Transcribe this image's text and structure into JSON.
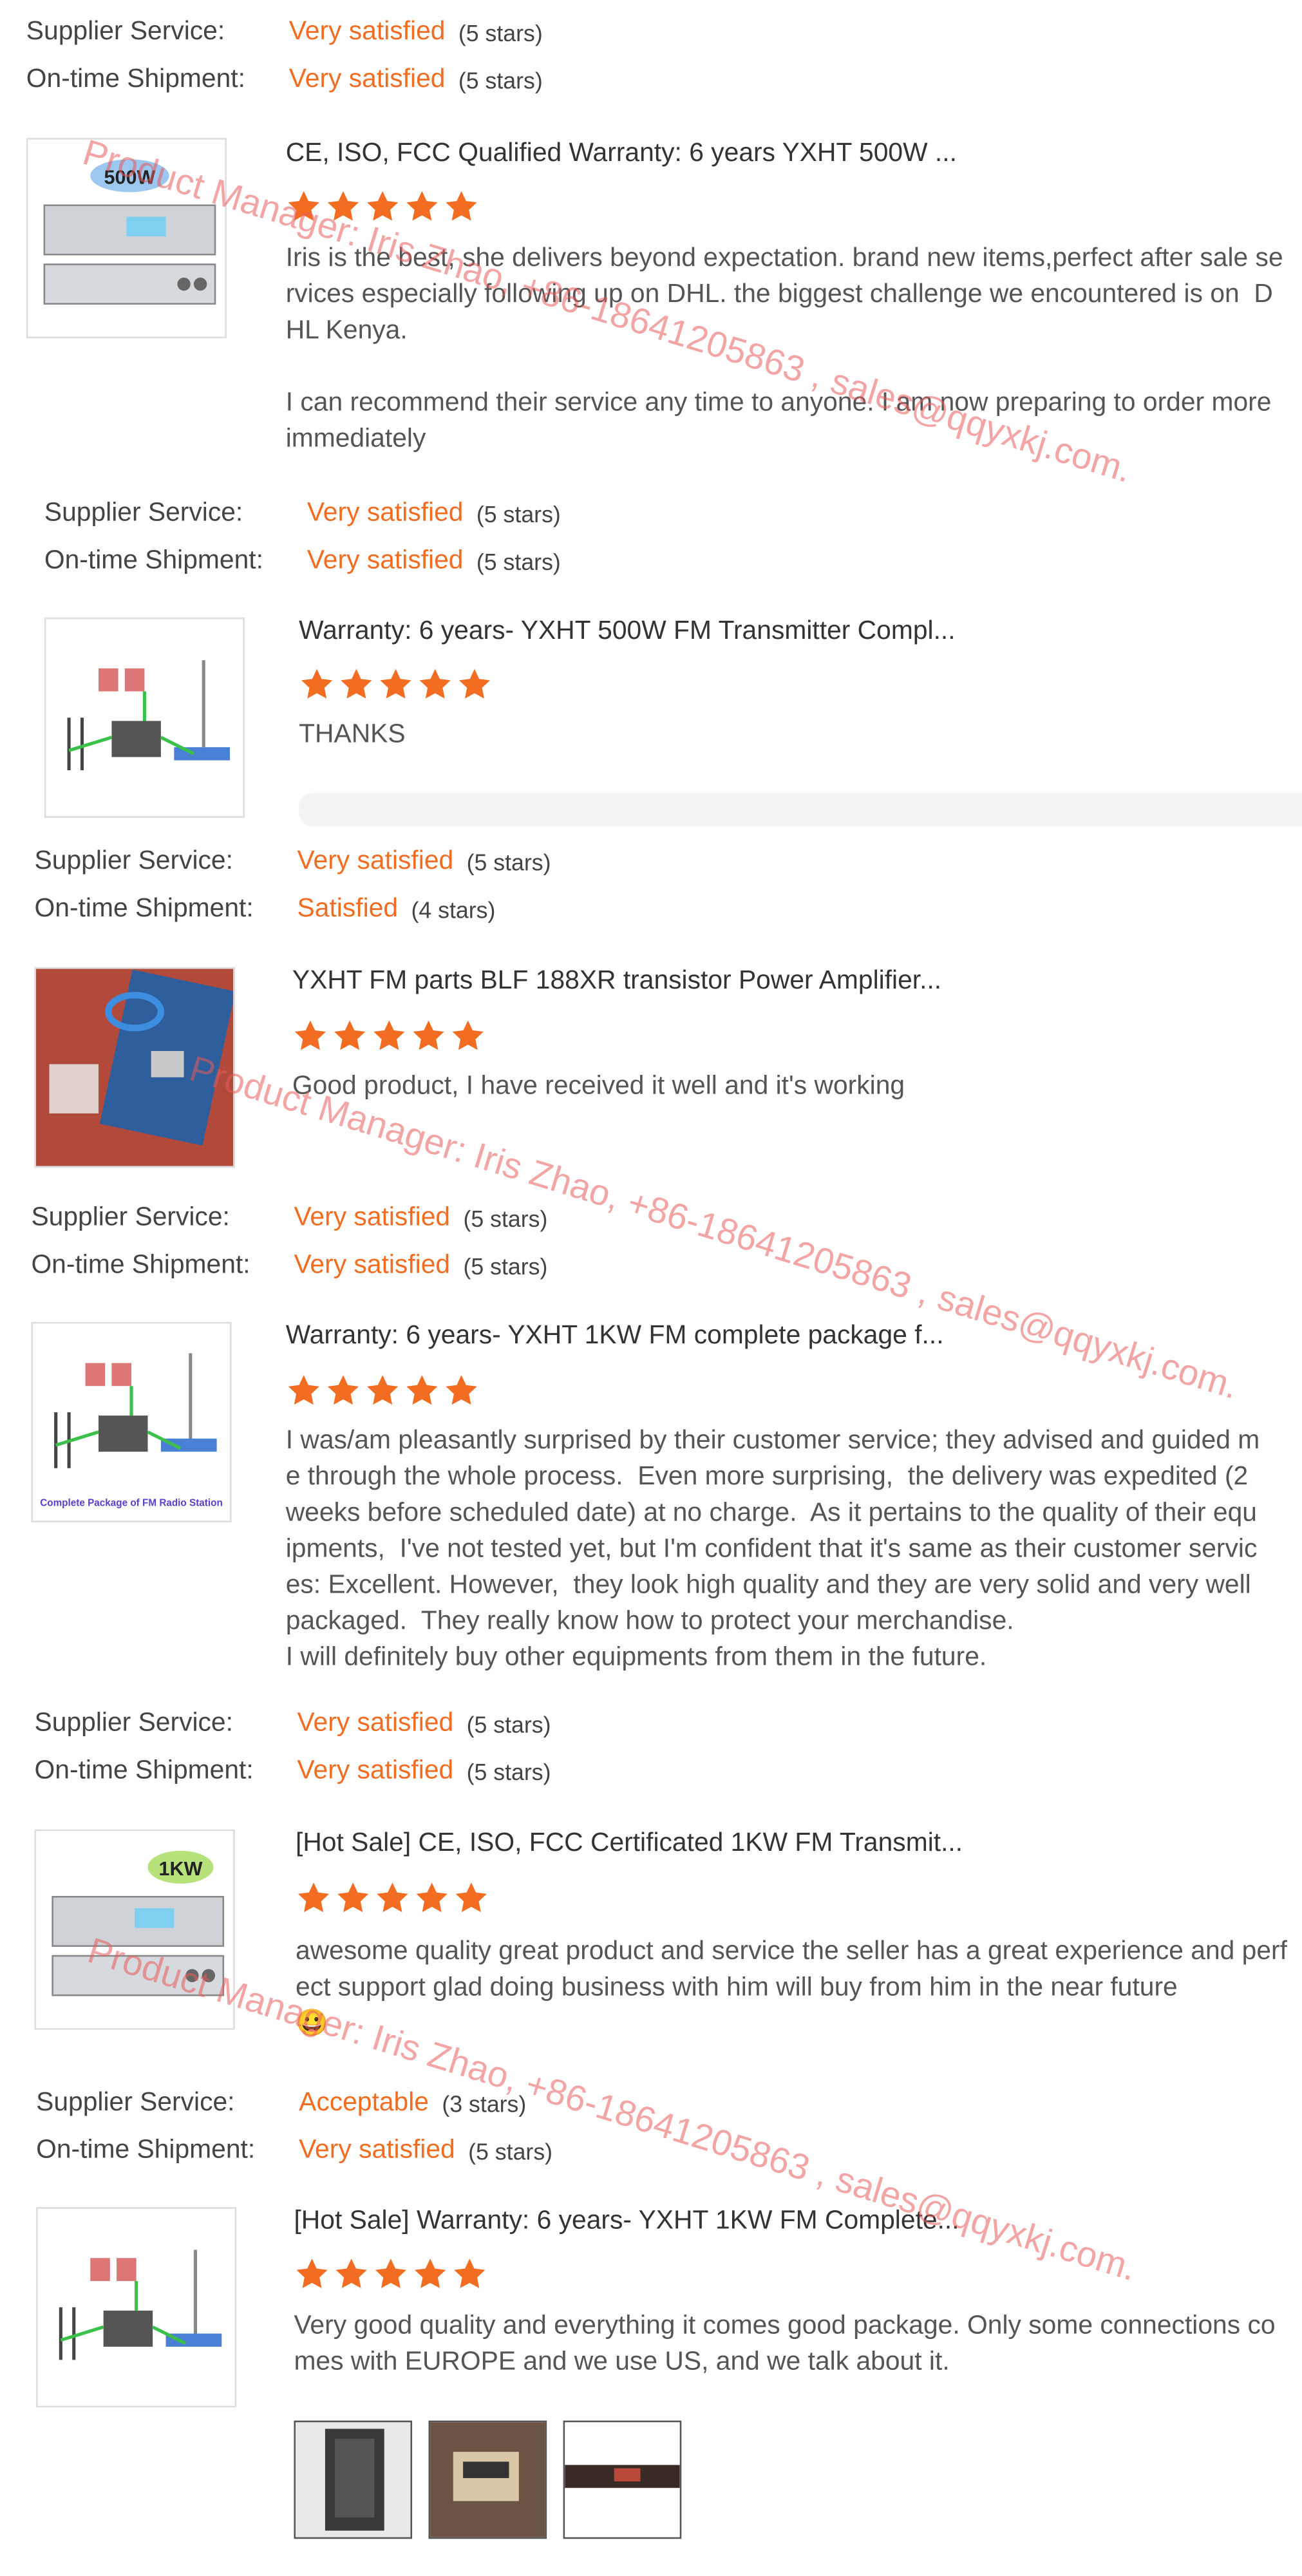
{
  "colors": {
    "accent": "#f26d21",
    "star": "#f26d21"
  },
  "watermark_text": "Product Manager: Iris Zhao, +86-18641205863 , sales@qqyxkj.com.",
  "labels": {
    "supplier": "Supplier Service:",
    "shipment": "On-time Shipment:"
  },
  "ratings": [
    {
      "supplier_value": "Very satisfied",
      "supplier_stars": "(5 stars)",
      "shipment_value": "Very satisfied",
      "shipment_stars": "(5 stars)"
    },
    {
      "supplier_value": "Very satisfied",
      "supplier_stars": "(5 stars)",
      "shipment_value": "Very satisfied",
      "shipment_stars": "(5 stars)"
    },
    {
      "supplier_value": "Very satisfied",
      "supplier_stars": "(5 stars)",
      "shipment_value": "Satisfied",
      "shipment_stars": "(4 stars)"
    },
    {
      "supplier_value": "Very satisfied",
      "supplier_stars": "(5 stars)",
      "shipment_value": "Very satisfied",
      "shipment_stars": "(5 stars)"
    },
    {
      "supplier_value": "Very satisfied",
      "supplier_stars": "(5 stars)",
      "shipment_value": "Very satisfied",
      "shipment_stars": "(5 stars)"
    },
    {
      "supplier_value": "Acceptable",
      "supplier_stars": "(3 stars)",
      "shipment_value": "Very satisfied",
      "shipment_stars": "(5 stars)"
    }
  ],
  "reviews": [
    {
      "title": "CE, ISO, FCC Qualified Warranty: 6 years YXHT 500W ...",
      "stars": 5,
      "thumb_badge": "500W",
      "text": "Iris is the best, she delivers beyond expectation. brand new items,perfect after sale services especially following up on DHL. the biggest challenge we encountered is on  DHL Kenya.\n\nI can recommend their service any time to anyone. I am now preparing to order more immediately"
    },
    {
      "title": "Warranty: 6 years- YXHT 500W FM Transmitter Compl...",
      "stars": 5,
      "text": "THANKS"
    },
    {
      "title": "YXHT FM parts BLF 188XR transistor Power Amplifier...",
      "stars": 5,
      "text": "Good product,  I have received it well and it's working"
    },
    {
      "title": "Warranty: 6 years- YXHT 1KW FM complete package f...",
      "stars": 5,
      "thumb_caption": "Complete Package of FM Radio Station",
      "text": "I was/am pleasantly surprised by their customer service; they advised and guided me through the whole process.  Even more surprising,  the delivery was expedited (2 weeks before scheduled date) at no charge.  As it pertains to the quality of their equipments,  I've not tested yet, but I'm confident that it's same as their customer services: Excellent. However,  they look high quality and they are very solid and very well packaged.  They really know how to protect your merchandise.\nI will definitely buy other equipments from them in the future."
    },
    {
      "title": "[Hot Sale] CE, ISO, FCC Certificated 1KW FM Transmit...",
      "stars": 5,
      "thumb_badge": "1KW",
      "text": "awesome quality great product and service the seller has a great experience and perfect support glad doing business with him will buy from him in the near future",
      "emoji": "😀"
    },
    {
      "title": "[Hot Sale] Warranty: 6 years- YXHT 1KW FM Complete...",
      "stars": 5,
      "text": "Very good quality and everything it comes good package. Only some connections comes with EUROPE and we use US, and we talk about it."
    }
  ]
}
